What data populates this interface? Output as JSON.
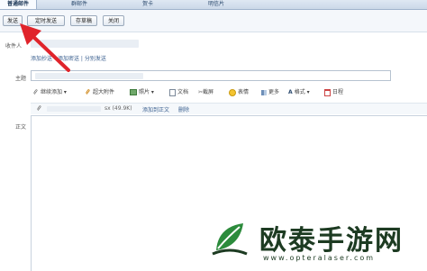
{
  "tabs": [
    {
      "label": "普通邮件",
      "active": true
    },
    {
      "label": "群邮件",
      "active": false
    },
    {
      "label": "贺卡",
      "active": false
    },
    {
      "label": "明信片",
      "active": false
    }
  ],
  "toolbar": {
    "send": "发送",
    "scheduled": "定时发送",
    "draft": "存草稿",
    "close": "关闭"
  },
  "compose": {
    "to_label": "收件人",
    "cc_links": "添加抄送 - 添加密送 | 分别发送",
    "subject_label": "主题",
    "body_label": "正文"
  },
  "editor_toolbar": {
    "attach": "继续添加",
    "big_attach": "超大附件",
    "photo": "照片",
    "doc": "文档",
    "screenshot": "截屏",
    "emoji": "表情",
    "more": "更多",
    "format": "格式",
    "calendar": "日程"
  },
  "attachment": {
    "size": "sx (49.9K)",
    "add_to_body": "添加到正文",
    "delete": "删除"
  },
  "watermark": {
    "brand": "欧泰手游网",
    "url": "www.opteralaser.com"
  },
  "colors": {
    "accent": "#2c4a6e",
    "arrow": "#e0242b",
    "brand_green": "#2c8b3c",
    "brand_dark": "#1d3b22"
  }
}
